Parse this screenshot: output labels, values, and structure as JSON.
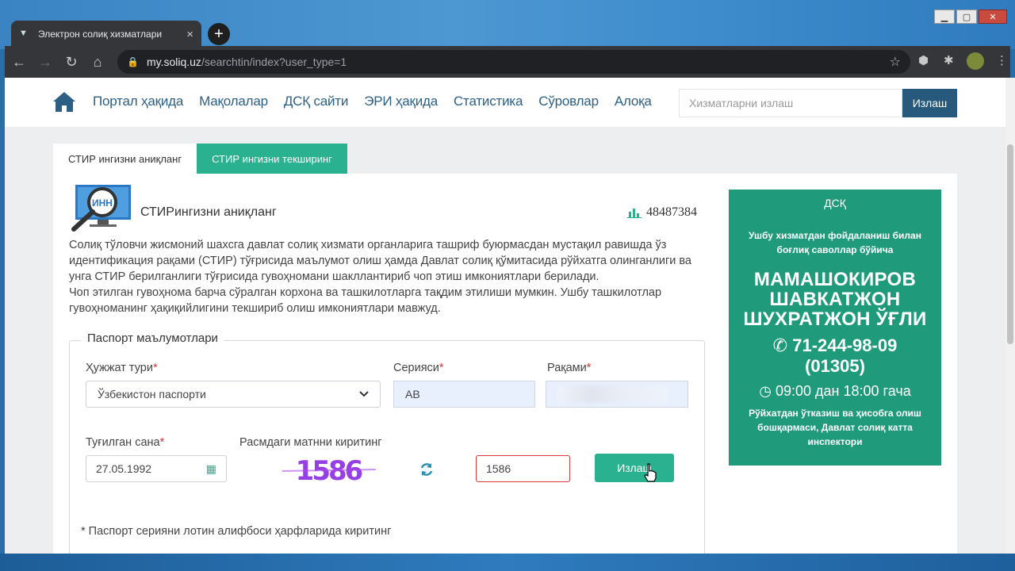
{
  "browser": {
    "tab_title": "Электрон солиқ хизматлари",
    "tab_close": "×",
    "new_tab": "+",
    "url_host": "my.soliq.uz",
    "url_path": "/searchtin/index?user_type=1"
  },
  "nav": {
    "items": [
      "Портал ҳақида",
      "Мақолалар",
      "ДСҚ сайти",
      "ЭРИ ҳақида",
      "Статистика",
      "Сўровлар",
      "Алоқа"
    ],
    "search_placeholder": "Хизматларни излаш",
    "search_button": "Излаш"
  },
  "tabs": {
    "active": "СТИР ингизни аниқланг",
    "other": "СТИР ингизни текширинг"
  },
  "service": {
    "icon_text": "ИНН",
    "title": "СТИРингизни аниқланг",
    "counter": "48487384",
    "desc_lines": [
      "Солиқ тўловчи жисмоний шахсга давлат солиқ хизмати органларига ташриф буюрмасдан мустақил равишда ўз",
      "идентификация рақами (СТИР) тўғрисида маълумот олиш ҳамда Давлат солиқ қўмитасида рўйхатга олинганлиги ва",
      "унга СТИР берилганлиги тўғрисида гувоҳномани шакллантириб чоп этиш имкониятлари берилади.",
      "Чоп этилган гувоҳнома барча сўралган корхона ва ташкилотларга тақдим этилиши мумкин. Ушбу ташкилотлар",
      "гувоҳноманинг ҳақиқийлигини текшириб олиш имкониятлари мавжуд."
    ]
  },
  "form": {
    "legend": "Паспорт маълумотлари",
    "required_mark": "*",
    "doc_type_label": "Ҳужжат тури",
    "doc_type_value": "Ўзбекистон паспорти",
    "series_label": "Серияси",
    "series_value": "AB",
    "number_label": "Рақами",
    "birth_label": "Туғилган сана",
    "birth_value": "27.05.1992",
    "captcha_label": "Расмдаги матнни киритинг",
    "captcha_text": "1586",
    "captcha_input": "1586",
    "submit": "Излаш",
    "note": "* Паспорт серияни лотин алифбоси ҳарфларида киритинг"
  },
  "info": {
    "org": "ДСҚ",
    "intro": "Ушбу хизматдан фойдаланиш билан боғлиқ саволлар бўйича",
    "name_lines": [
      "МАМАШОКИРОВ",
      "ШАВКАТЖОН",
      "ШУХРАТЖОН ЎҒЛИ"
    ],
    "phone": "71-244-98-09",
    "ext": "(01305)",
    "hours": "09:00 дан 18:00 гача",
    "footer": "Рўйхатдан ўтказиш ва ҳисобга олиш бошқармаси, Давлат солиқ катта инспектори"
  },
  "colors": {
    "accent": "#2ab190",
    "brand": "#27597c",
    "info_bg": "#1f9b7c",
    "error": "#d9383a"
  }
}
